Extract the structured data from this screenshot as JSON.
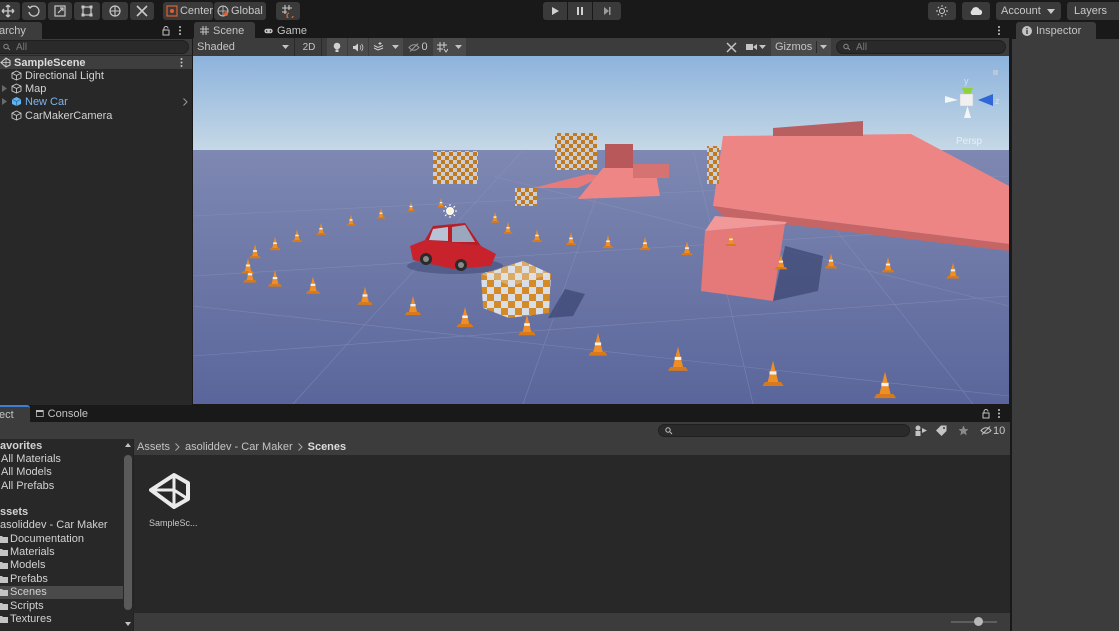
{
  "toolbar": {
    "tools": [
      {
        "name": "move-tool",
        "icon": "move-icon"
      },
      {
        "name": "rotate-tool",
        "icon": "rotate-icon"
      },
      {
        "name": "scale-tool",
        "icon": "scale-icon"
      },
      {
        "name": "rect-tool",
        "icon": "rect-icon"
      },
      {
        "name": "transform-tool",
        "icon": "transform-icon"
      },
      {
        "name": "custom-tool",
        "icon": "tools-icon"
      }
    ],
    "pivot_label": "Center",
    "space_label": "Global",
    "snap_icon": "grid-snap-icon",
    "play_icon": "play-icon",
    "pause_icon": "pause-icon",
    "step_icon": "step-icon",
    "account_label": "Account",
    "layers_label": "Layers"
  },
  "hierarchy": {
    "tab_label": "archy",
    "search_placeholder": "All",
    "scene_name": "SampleScene",
    "items": [
      {
        "label": "Directional Light",
        "expandable": false,
        "prefab": false
      },
      {
        "label": "Map",
        "expandable": true,
        "prefab": false
      },
      {
        "label": "New Car",
        "expandable": true,
        "prefab": true
      },
      {
        "label": "CarMakerCamera",
        "expandable": false,
        "prefab": false
      }
    ]
  },
  "scene_view": {
    "tabs": [
      {
        "label": "Scene",
        "icon": "grid-icon",
        "active": true
      },
      {
        "label": "Game",
        "icon": "gamepad-icon",
        "active": false
      }
    ],
    "shading_mode": "Shaded",
    "mode_2d": "2D",
    "hidden_count": "0",
    "gizmos_label": "Gizmos",
    "search_placeholder": "All",
    "gizmo": {
      "y": "y",
      "z": "z",
      "projection": "Persp"
    }
  },
  "inspector": {
    "tab_label": "Inspector"
  },
  "project": {
    "tabs": [
      {
        "label": "ect",
        "active": true
      },
      {
        "label": "Console",
        "active": false
      }
    ],
    "hidden_count": "10",
    "breadcrumb": [
      "Assets",
      "asoliddev - Car Maker",
      "Scenes"
    ],
    "tree": {
      "favorites_label": "avorites",
      "favorites": [
        "All Materials",
        "All Models",
        "All Prefabs"
      ],
      "assets_label": "ssets",
      "root_folder": "asoliddev - Car Maker",
      "folders": [
        "Documentation",
        "Materials",
        "Models",
        "Prefabs",
        "Scenes",
        "Scripts",
        "Textures"
      ],
      "selected_folder": "Scenes"
    },
    "files": [
      {
        "label": "SampleSc...",
        "type": "scene"
      }
    ],
    "zoom_slider_value": 0.6
  },
  "colors": {
    "accent_blue": "#7cb3f0",
    "selection": "#4a4a4a",
    "sky": "#a9c6e3",
    "ground": "#5e6a9c",
    "platform": "#ec7f7f",
    "car_red": "#c8232c",
    "cone_orange": "#e88a1f"
  }
}
